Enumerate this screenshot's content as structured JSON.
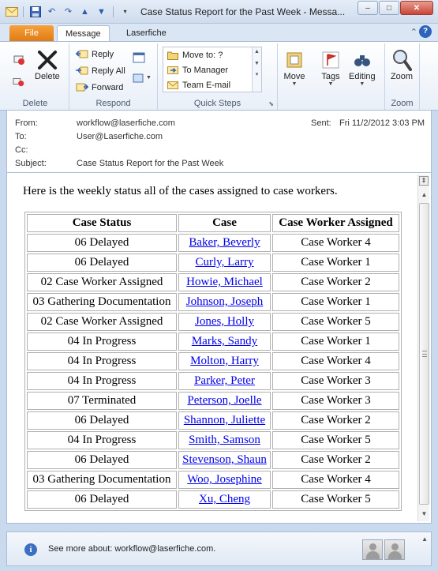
{
  "window": {
    "title": "Case Status Report for the Past Week  -  Messa...",
    "controls": {
      "minimize": "–",
      "maximize": "□",
      "close": "✕"
    }
  },
  "tabs": {
    "file": "File",
    "message": "Message",
    "laserfiche": "Laserfiche",
    "help": "?"
  },
  "ribbon": {
    "delete": {
      "label": "Delete",
      "group": "Delete"
    },
    "respond": {
      "reply": "Reply",
      "reply_all": "Reply All",
      "forward": "Forward",
      "group": "Respond"
    },
    "quick_steps": {
      "items": [
        "Move to: ?",
        "To Manager",
        "Team E-mail"
      ],
      "group": "Quick Steps"
    },
    "move": "Move",
    "tags": "Tags",
    "editing": "Editing",
    "zoom": {
      "label": "Zoom",
      "group": "Zoom"
    }
  },
  "headers": {
    "from_label": "From:",
    "from": "workflow@laserfiche.com",
    "to_label": "To:",
    "to": "User@Laserfiche.com",
    "cc_label": "Cc:",
    "cc": "",
    "subject_label": "Subject:",
    "subject": "Case Status Report for the Past Week",
    "sent_label": "Sent:",
    "sent": "Fri 11/2/2012 3:03 PM"
  },
  "body": {
    "intro": "Here is the weekly status all of the cases assigned to case workers.",
    "table": {
      "columns": [
        "Case Status",
        "Case",
        "Case Worker Assigned"
      ],
      "rows": [
        [
          "06 Delayed",
          "Baker, Beverly",
          "Case Worker 4"
        ],
        [
          "06 Delayed",
          "Curly, Larry",
          "Case Worker 1"
        ],
        [
          "02 Case Worker Assigned",
          "Howie, Michael",
          "Case Worker 2"
        ],
        [
          "03 Gathering Documentation",
          "Johnson, Joseph",
          "Case Worker 1"
        ],
        [
          "02 Case Worker Assigned",
          "Jones, Holly",
          "Case Worker 5"
        ],
        [
          "04 In Progress",
          "Marks, Sandy",
          "Case Worker 1"
        ],
        [
          "04 In Progress",
          "Molton, Harry",
          "Case Worker 4"
        ],
        [
          "04 In Progress",
          "Parker, Peter",
          "Case Worker 3"
        ],
        [
          "07 Terminated",
          "Peterson, Joelle",
          "Case Worker 3"
        ],
        [
          "06 Delayed",
          "Shannon, Juliette",
          "Case Worker 2"
        ],
        [
          "04 In Progress",
          "Smith, Samson",
          "Case Worker 5"
        ],
        [
          "06 Delayed",
          "Stevenson, Shaun",
          "Case Worker 2"
        ],
        [
          "03 Gathering Documentation",
          "Woo, Josephine",
          "Case Worker 4"
        ],
        [
          "06 Delayed",
          "Xu, Cheng",
          "Case Worker 5"
        ]
      ]
    }
  },
  "people_pane": {
    "see_more": "See more about: workflow@laserfiche.com."
  },
  "colors": {
    "file_tab": "#e07b12",
    "link": "#0000ee",
    "chrome": "#c9d9ee"
  }
}
